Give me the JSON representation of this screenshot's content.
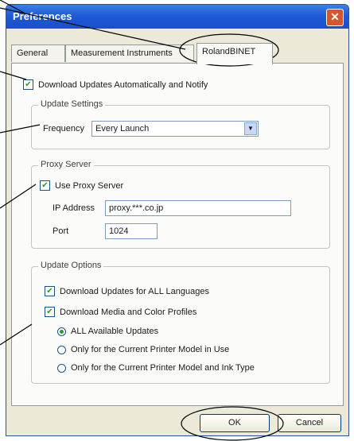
{
  "window": {
    "title": "Preferences",
    "close_glyph": "✕"
  },
  "tabs": [
    {
      "label": "General"
    },
    {
      "label": "Measurement Instruments"
    },
    {
      "label": "RolandBINET",
      "active": true
    }
  ],
  "auto_update": {
    "label": "Download Updates Automatically and Notify",
    "checked": true
  },
  "update_settings": {
    "title": "Update Settings",
    "frequency_label": "Frequency",
    "frequency_value": "Every Launch"
  },
  "proxy": {
    "title": "Proxy Server",
    "use_label": "Use Proxy Server",
    "use_checked": true,
    "ip_label": "IP Address",
    "ip_value": "proxy.***.co.jp",
    "port_label": "Port",
    "port_value": "1024"
  },
  "update_options": {
    "title": "Update Options",
    "all_languages_label": "Download Updates for ALL Languages",
    "all_languages_checked": true,
    "media_label": "Download Media and Color Profiles",
    "media_checked": true,
    "radios": [
      {
        "label": "ALL Available Updates",
        "selected": true
      },
      {
        "label": "Only for the Current Printer Model in Use",
        "selected": false
      },
      {
        "label": "Only for the Current Printer Model and Ink Type",
        "selected": false
      }
    ]
  },
  "buttons": {
    "ok": "OK",
    "cancel": "Cancel"
  },
  "check_glyph": "✔",
  "dropdown_glyph": "▼",
  "colors": {
    "titlebar": "#1f5ad6",
    "check": "#21a121",
    "dialog_bg": "#ece9d8"
  }
}
